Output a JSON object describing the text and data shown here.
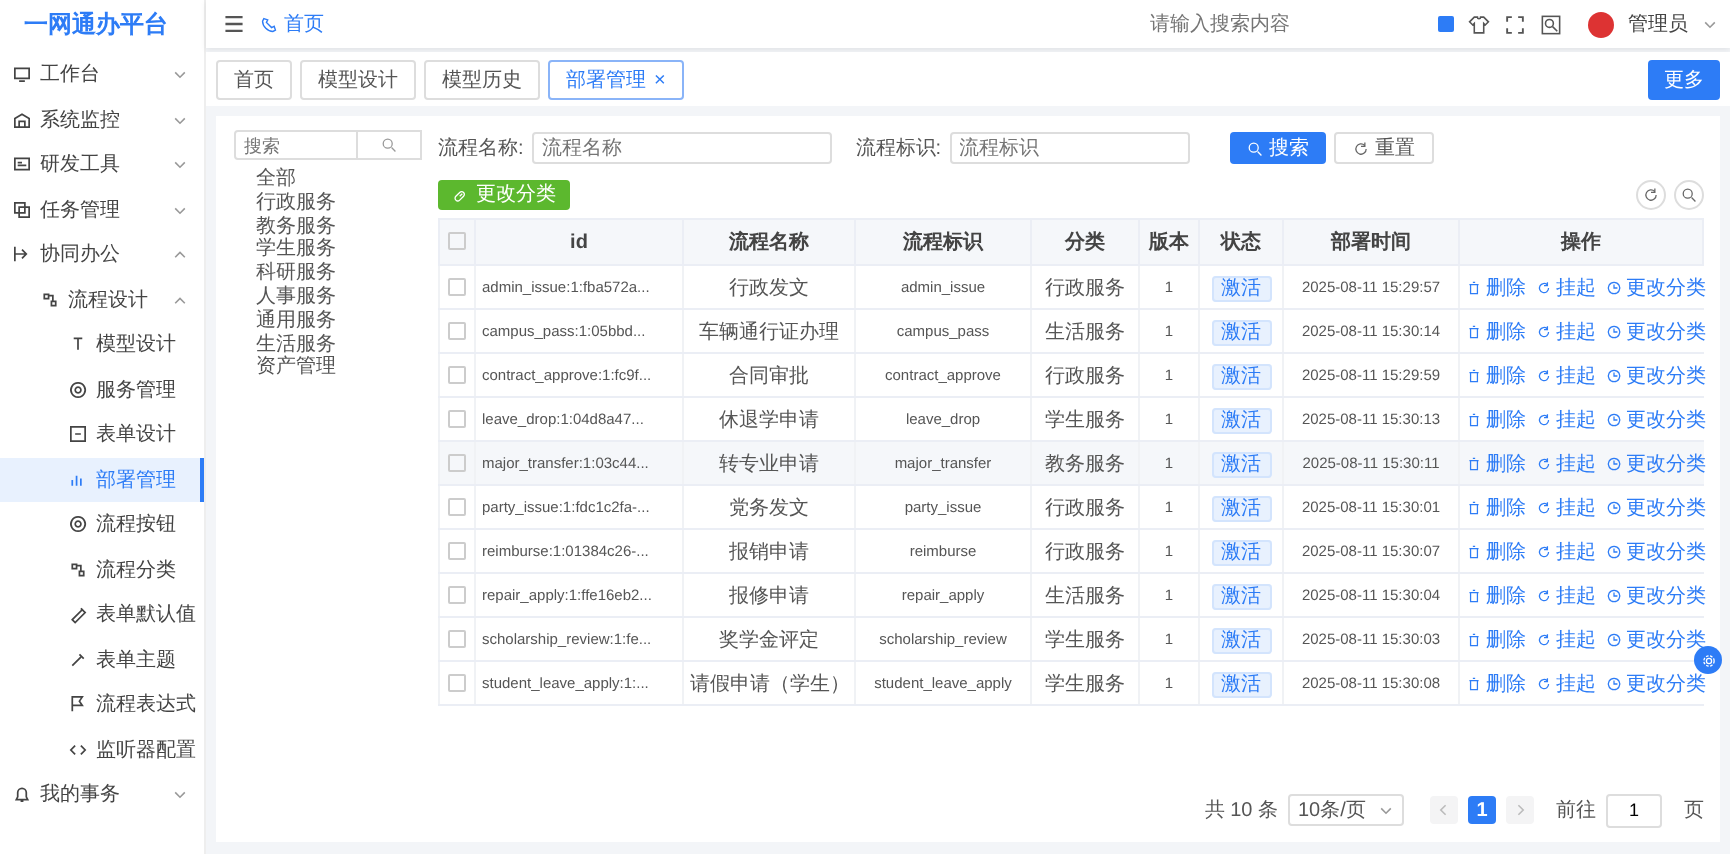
{
  "header": {
    "logo": "一网通办平台",
    "home_link": "首页",
    "search": {
      "placeholder": "请输入搜索内容"
    },
    "user": "管理员"
  },
  "sidebar": {
    "items": [
      {
        "label": "工作台",
        "expanded": false
      },
      {
        "label": "系统监控",
        "expanded": false
      },
      {
        "label": "研发工具",
        "expanded": false
      },
      {
        "label": "任务管理",
        "expanded": false
      },
      {
        "label": "协同办公",
        "expanded": true,
        "children": [
          {
            "label": "流程设计",
            "expanded": true,
            "children": [
              {
                "label": "模型设计",
                "selected": false
              },
              {
                "label": "服务管理",
                "selected": false
              },
              {
                "label": "表单设计",
                "selected": false
              },
              {
                "label": "部署管理",
                "selected": true
              },
              {
                "label": "流程按钮",
                "selected": false
              },
              {
                "label": "流程分类",
                "selected": false
              },
              {
                "label": "表单默认值",
                "selected": false
              },
              {
                "label": "表单主题",
                "selected": false
              },
              {
                "label": "流程表达式",
                "selected": false
              },
              {
                "label": "监听器配置",
                "selected": false
              }
            ]
          }
        ]
      },
      {
        "label": "我的事务",
        "expanded": false
      }
    ]
  },
  "tabs": [
    {
      "label": "首页",
      "selected": false,
      "closable": false
    },
    {
      "label": "模型设计",
      "selected": false,
      "closable": false
    },
    {
      "label": "模型历史",
      "selected": false,
      "closable": false
    },
    {
      "label": "部署管理",
      "selected": true,
      "closable": true,
      "close": "×"
    }
  ],
  "more_button": "更多",
  "category_tree": {
    "search": {
      "placeholder": "搜索"
    },
    "items": [
      "全部",
      "行政服务",
      "教务服务",
      "学生服务",
      "科研服务",
      "人事服务",
      "通用服务",
      "生活服务",
      "资产管理"
    ]
  },
  "filters": [
    {
      "label": "流程名称:",
      "placeholder": "流程名称"
    },
    {
      "label": "流程标识:",
      "placeholder": "流程标识"
    }
  ],
  "search_button": "搜索",
  "reset_button": "重置",
  "change_category_button": "更改分类",
  "table": {
    "header_checked": false,
    "columns": [
      "id",
      "流程名称",
      "流程标识",
      "分类",
      "版本",
      "状态",
      "部署时间",
      "操作"
    ],
    "rows": [
      {
        "checked": false,
        "id": "admin_issue:1:fba572a...",
        "name": "行政发文",
        "key": "admin_issue",
        "category": "行政服务",
        "version": "1",
        "status": "激活",
        "time": "2025-08-11 15:29:57",
        "actions": [
          "删除",
          "挂起",
          "更改分类"
        ]
      },
      {
        "checked": false,
        "id": "campus_pass:1:05bbd...",
        "name": "车辆通行证办理",
        "key": "campus_pass",
        "category": "生活服务",
        "version": "1",
        "status": "激活",
        "time": "2025-08-11 15:30:14",
        "actions": [
          "删除",
          "挂起",
          "更改分类"
        ]
      },
      {
        "checked": false,
        "id": "contract_approve:1:fc9f...",
        "name": "合同审批",
        "key": "contract_approve",
        "category": "行政服务",
        "version": "1",
        "status": "激活",
        "time": "2025-08-11 15:29:59",
        "actions": [
          "删除",
          "挂起",
          "更改分类"
        ]
      },
      {
        "checked": false,
        "id": "leave_drop:1:04d8a47...",
        "name": "休退学申请",
        "key": "leave_drop",
        "category": "学生服务",
        "version": "1",
        "status": "激活",
        "time": "2025-08-11 15:30:13",
        "actions": [
          "删除",
          "挂起",
          "更改分类"
        ]
      },
      {
        "checked": false,
        "id": "major_transfer:1:03c44...",
        "name": "转专业申请",
        "key": "major_transfer",
        "category": "教务服务",
        "version": "1",
        "status": "激活",
        "time": "2025-08-11 15:30:11",
        "actions": [
          "删除",
          "挂起",
          "更改分类"
        ]
      },
      {
        "checked": false,
        "id": "party_issue:1:fdc1c2fa-...",
        "name": "党务发文",
        "key": "party_issue",
        "category": "行政服务",
        "version": "1",
        "status": "激活",
        "time": "2025-08-11 15:30:01",
        "actions": [
          "删除",
          "挂起",
          "更改分类"
        ]
      },
      {
        "checked": false,
        "id": "reimburse:1:01384c26-...",
        "name": "报销申请",
        "key": "reimburse",
        "category": "行政服务",
        "version": "1",
        "status": "激活",
        "time": "2025-08-11 15:30:07",
        "actions": [
          "删除",
          "挂起",
          "更改分类"
        ]
      },
      {
        "checked": false,
        "id": "repair_apply:1:ffe16eb2...",
        "name": "报修申请",
        "key": "repair_apply",
        "category": "生活服务",
        "version": "1",
        "status": "激活",
        "time": "2025-08-11 15:30:04",
        "actions": [
          "删除",
          "挂起",
          "更改分类"
        ]
      },
      {
        "checked": false,
        "id": "scholarship_review:1:fe...",
        "name": "奖学金评定",
        "key": "scholarship_review",
        "category": "学生服务",
        "version": "1",
        "status": "激活",
        "time": "2025-08-11 15:30:03",
        "actions": [
          "删除",
          "挂起",
          "更改分类"
        ]
      },
      {
        "checked": false,
        "id": "student_leave_apply:1:...",
        "name": "请假申请（学生）",
        "key": "student_leave_apply",
        "category": "学生服务",
        "version": "1",
        "status": "激活",
        "time": "2025-08-11 15:30:08",
        "actions": [
          "删除",
          "挂起",
          "更改分类"
        ]
      }
    ]
  },
  "pagination": {
    "total": "共 10 条",
    "page_size": "10条/页",
    "pages": [
      {
        "label": "1",
        "selected": true
      }
    ],
    "goto_label": "前往",
    "goto_value": "1",
    "page_suffix": "页"
  }
}
